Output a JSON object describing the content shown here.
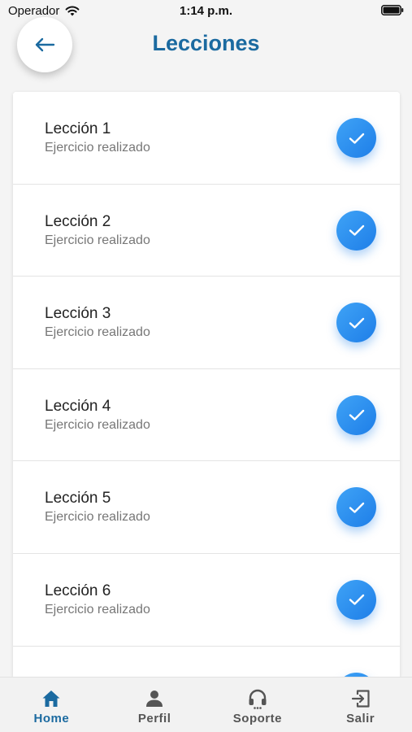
{
  "status_bar": {
    "carrier": "Operador",
    "time": "1:14 p.m."
  },
  "header": {
    "title": "Lecciones"
  },
  "lessons": [
    {
      "title": "Lección 1",
      "status": "Ejercicio realizado"
    },
    {
      "title": "Lección 2",
      "status": "Ejercicio realizado"
    },
    {
      "title": "Lección 3",
      "status": "Ejercicio realizado"
    },
    {
      "title": "Lección 4",
      "status": "Ejercicio realizado"
    },
    {
      "title": "Lección 5",
      "status": "Ejercicio realizado"
    },
    {
      "title": "Lección 6",
      "status": "Ejercicio realizado"
    },
    {
      "title": "",
      "status": ""
    }
  ],
  "nav": {
    "home": "Home",
    "profile": "Perfil",
    "support": "Soporte",
    "logout": "Salir"
  },
  "colors": {
    "accent": "#1b6aa0",
    "check": "#2a8cf0",
    "background": "#f4f4f4"
  },
  "icons": {
    "back": "arrow-left-icon",
    "check": "check-icon",
    "home": "home-icon",
    "profile": "person-icon",
    "support": "headset-icon",
    "logout": "logout-icon"
  }
}
